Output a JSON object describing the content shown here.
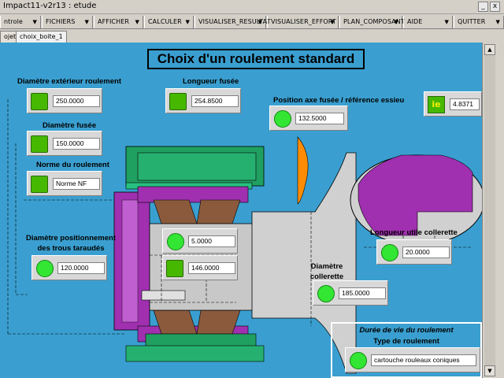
{
  "window": {
    "title": "Impact11-v2r13 : etude",
    "minimize": "_",
    "close": "x"
  },
  "menu": {
    "items": [
      {
        "label": "ntrole"
      },
      {
        "label": "FICHIERS"
      },
      {
        "label": "AFFICHER"
      },
      {
        "label": "CALCULER"
      },
      {
        "label": "VISUALISER_RESULTAT"
      },
      {
        "label": "VISUALISER_EFFORT"
      },
      {
        "label": "PLAN_COMPOSANT"
      },
      {
        "label": "AIDE"
      },
      {
        "label": "QUITTER"
      }
    ]
  },
  "tabs": {
    "projects": "ojets",
    "active": "choix_boite_1"
  },
  "screen": {
    "title": "Choix d'un roulement standard",
    "fields": {
      "outer_diameter": {
        "label": "Diamètre extérieur roulement",
        "value": "250.0000"
      },
      "spindle_diameter": {
        "label": "Diamètre fusée",
        "value": "150.0000"
      },
      "bearing_standard": {
        "label": "Norme du roulement",
        "value": "Norme NF"
      },
      "spindle_length": {
        "label": "Longueur fusée",
        "value": "254.8500"
      },
      "axis_position": {
        "label": "Position axe fusée / référence essieu",
        "value": "132.5000"
      },
      "result_value": {
        "value": "4.8371",
        "icon": "ie"
      },
      "threaded_holes": {
        "label": "Diamètre positionnement\ndes trous taraudés",
        "value": "120.0000"
      },
      "center_a": {
        "value": "5.0000"
      },
      "center_b": {
        "value": "146.0000"
      },
      "collar_diameter": {
        "label": "Diamètre\ncollerette",
        "value": "185.0000"
      },
      "collar_length": {
        "label": "Longueur utile collerette",
        "value": "20.0000"
      }
    },
    "lifetime_panel": {
      "title": "Durée de vie du roulement",
      "subtitle": "Type de roulement",
      "value": "cartouche rouleaux coniques"
    }
  },
  "colors": {
    "canvas": "#3a9fd0",
    "purple": "#a030b0",
    "green": "#20a060",
    "brown": "#8b5a3c",
    "orange": "#ff8c00"
  }
}
